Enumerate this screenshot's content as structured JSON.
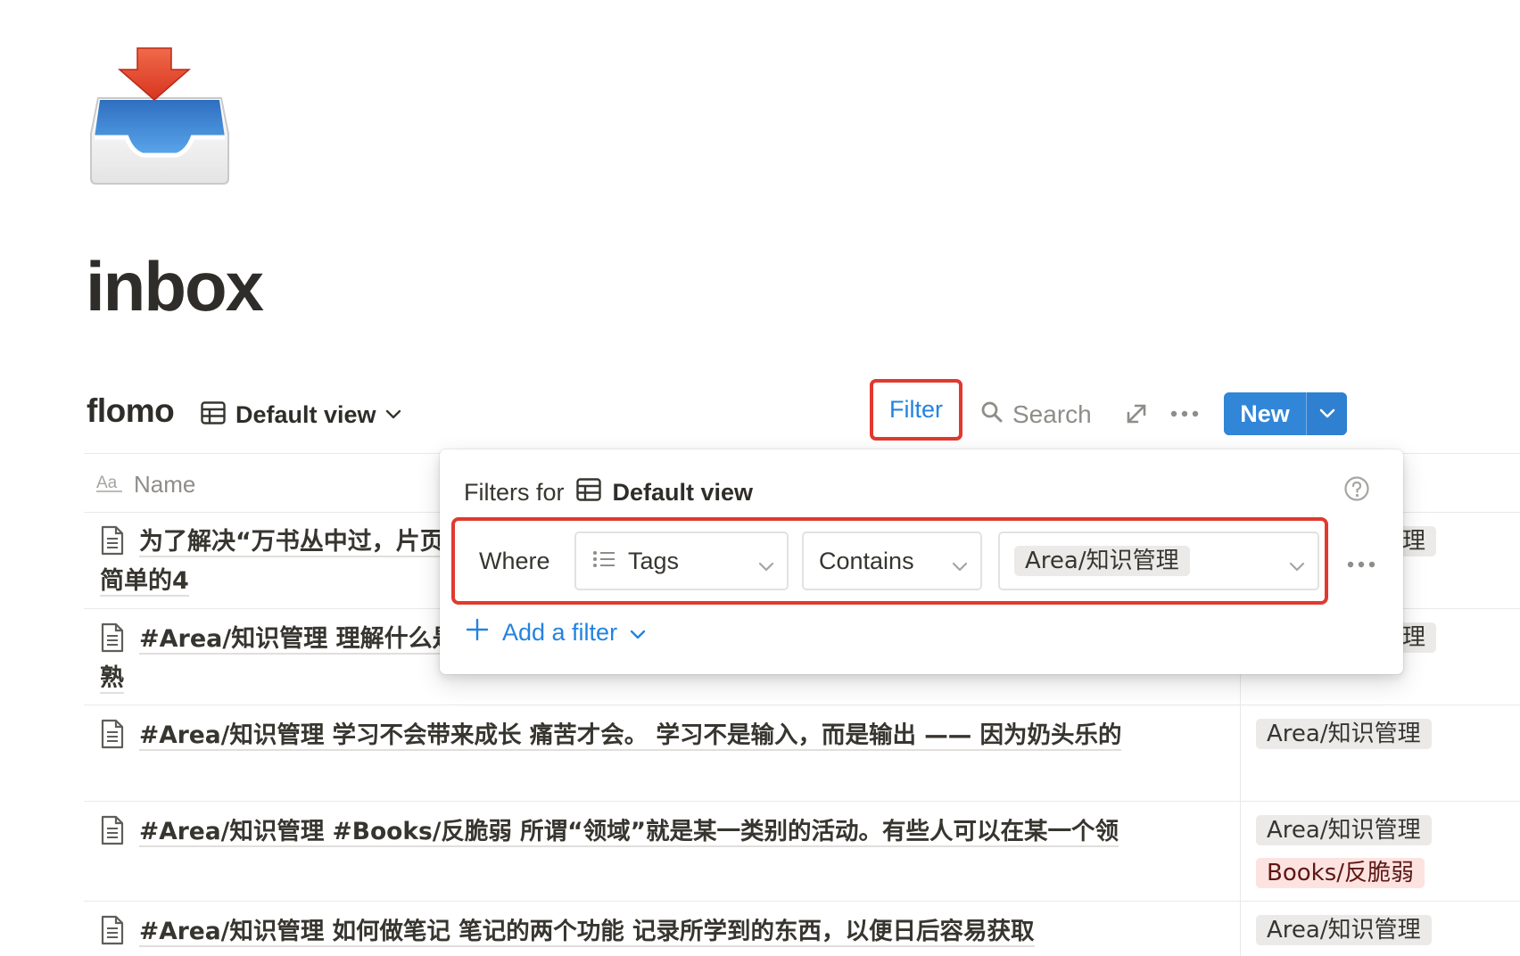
{
  "page": {
    "title": "inbox",
    "icon": "inbox-tray-icon"
  },
  "database": {
    "title": "flomo",
    "view": {
      "icon": "table-icon",
      "label": "Default view"
    }
  },
  "toolbar": {
    "filter_label": "Filter",
    "search_label": "Search",
    "new_label": "New"
  },
  "table": {
    "name_column": "Name",
    "rows": [
      {
        "line1": "为了解决“万书丛中过，片页",
        "line2": "简单的4",
        "tags": [
          {
            "label": "理",
            "color": "gray"
          }
        ]
      },
      {
        "line1": "#Area/知识管理 理解什么是",
        "line2": "熟",
        "tags": [
          {
            "label": "理",
            "color": "gray"
          }
        ]
      },
      {
        "line1": "#Area/知识管理 学习不会带来成长 痛苦才会。 学习不是输入，而是输出 —— 因为奶头乐的",
        "line2": "",
        "tags": [
          {
            "label": "Area/知识管理",
            "color": "gray"
          }
        ]
      },
      {
        "line1": "#Area/知识管理 #Books/反脆弱 所谓“领域”就是某一类别的活动。有些人可以在某一个领",
        "line2": "",
        "tags": [
          {
            "label": "Area/知识管理",
            "color": "gray"
          },
          {
            "label": "Books/反脆弱",
            "color": "red"
          }
        ]
      },
      {
        "line1": "#Area/知识管理 如何做笔记 笔记的两个功能 记录所学到的东西，以便日后容易获取",
        "line2": "",
        "tags": [
          {
            "label": "Area/知识管理",
            "color": "gray"
          }
        ]
      }
    ]
  },
  "filter_popover": {
    "heading_prefix": "Filters for",
    "heading_view": "Default view",
    "rule": {
      "where_label": "Where",
      "property": "Tags",
      "operator": "Contains",
      "value": "Area/知识管理"
    },
    "add_filter_label": "Add a filter"
  },
  "colors": {
    "accent": "#2383e2",
    "highlight_border": "#e03a2f",
    "new_button": "#3186d8",
    "tag_gray": "#ebeae8",
    "tag_red": "#fde3e0"
  }
}
